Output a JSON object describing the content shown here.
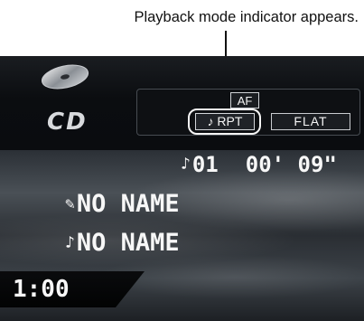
{
  "annotation": {
    "caption": "Playback mode indicator appears."
  },
  "source": {
    "label": "CD"
  },
  "indicators": {
    "af": "AF",
    "rpt": "♪ RPT",
    "flat": "FLAT"
  },
  "playback": {
    "track_icon": "♪",
    "track": "01",
    "elapsed": "00' 09\""
  },
  "disc_title": {
    "icon": "✎",
    "text": "NO NAME"
  },
  "track_title": {
    "icon": "♪",
    "text": "NO NAME"
  },
  "clock": {
    "time": "1:00"
  },
  "colors": {
    "screen_bg": "#07090b",
    "text": "#f7f7f7"
  }
}
